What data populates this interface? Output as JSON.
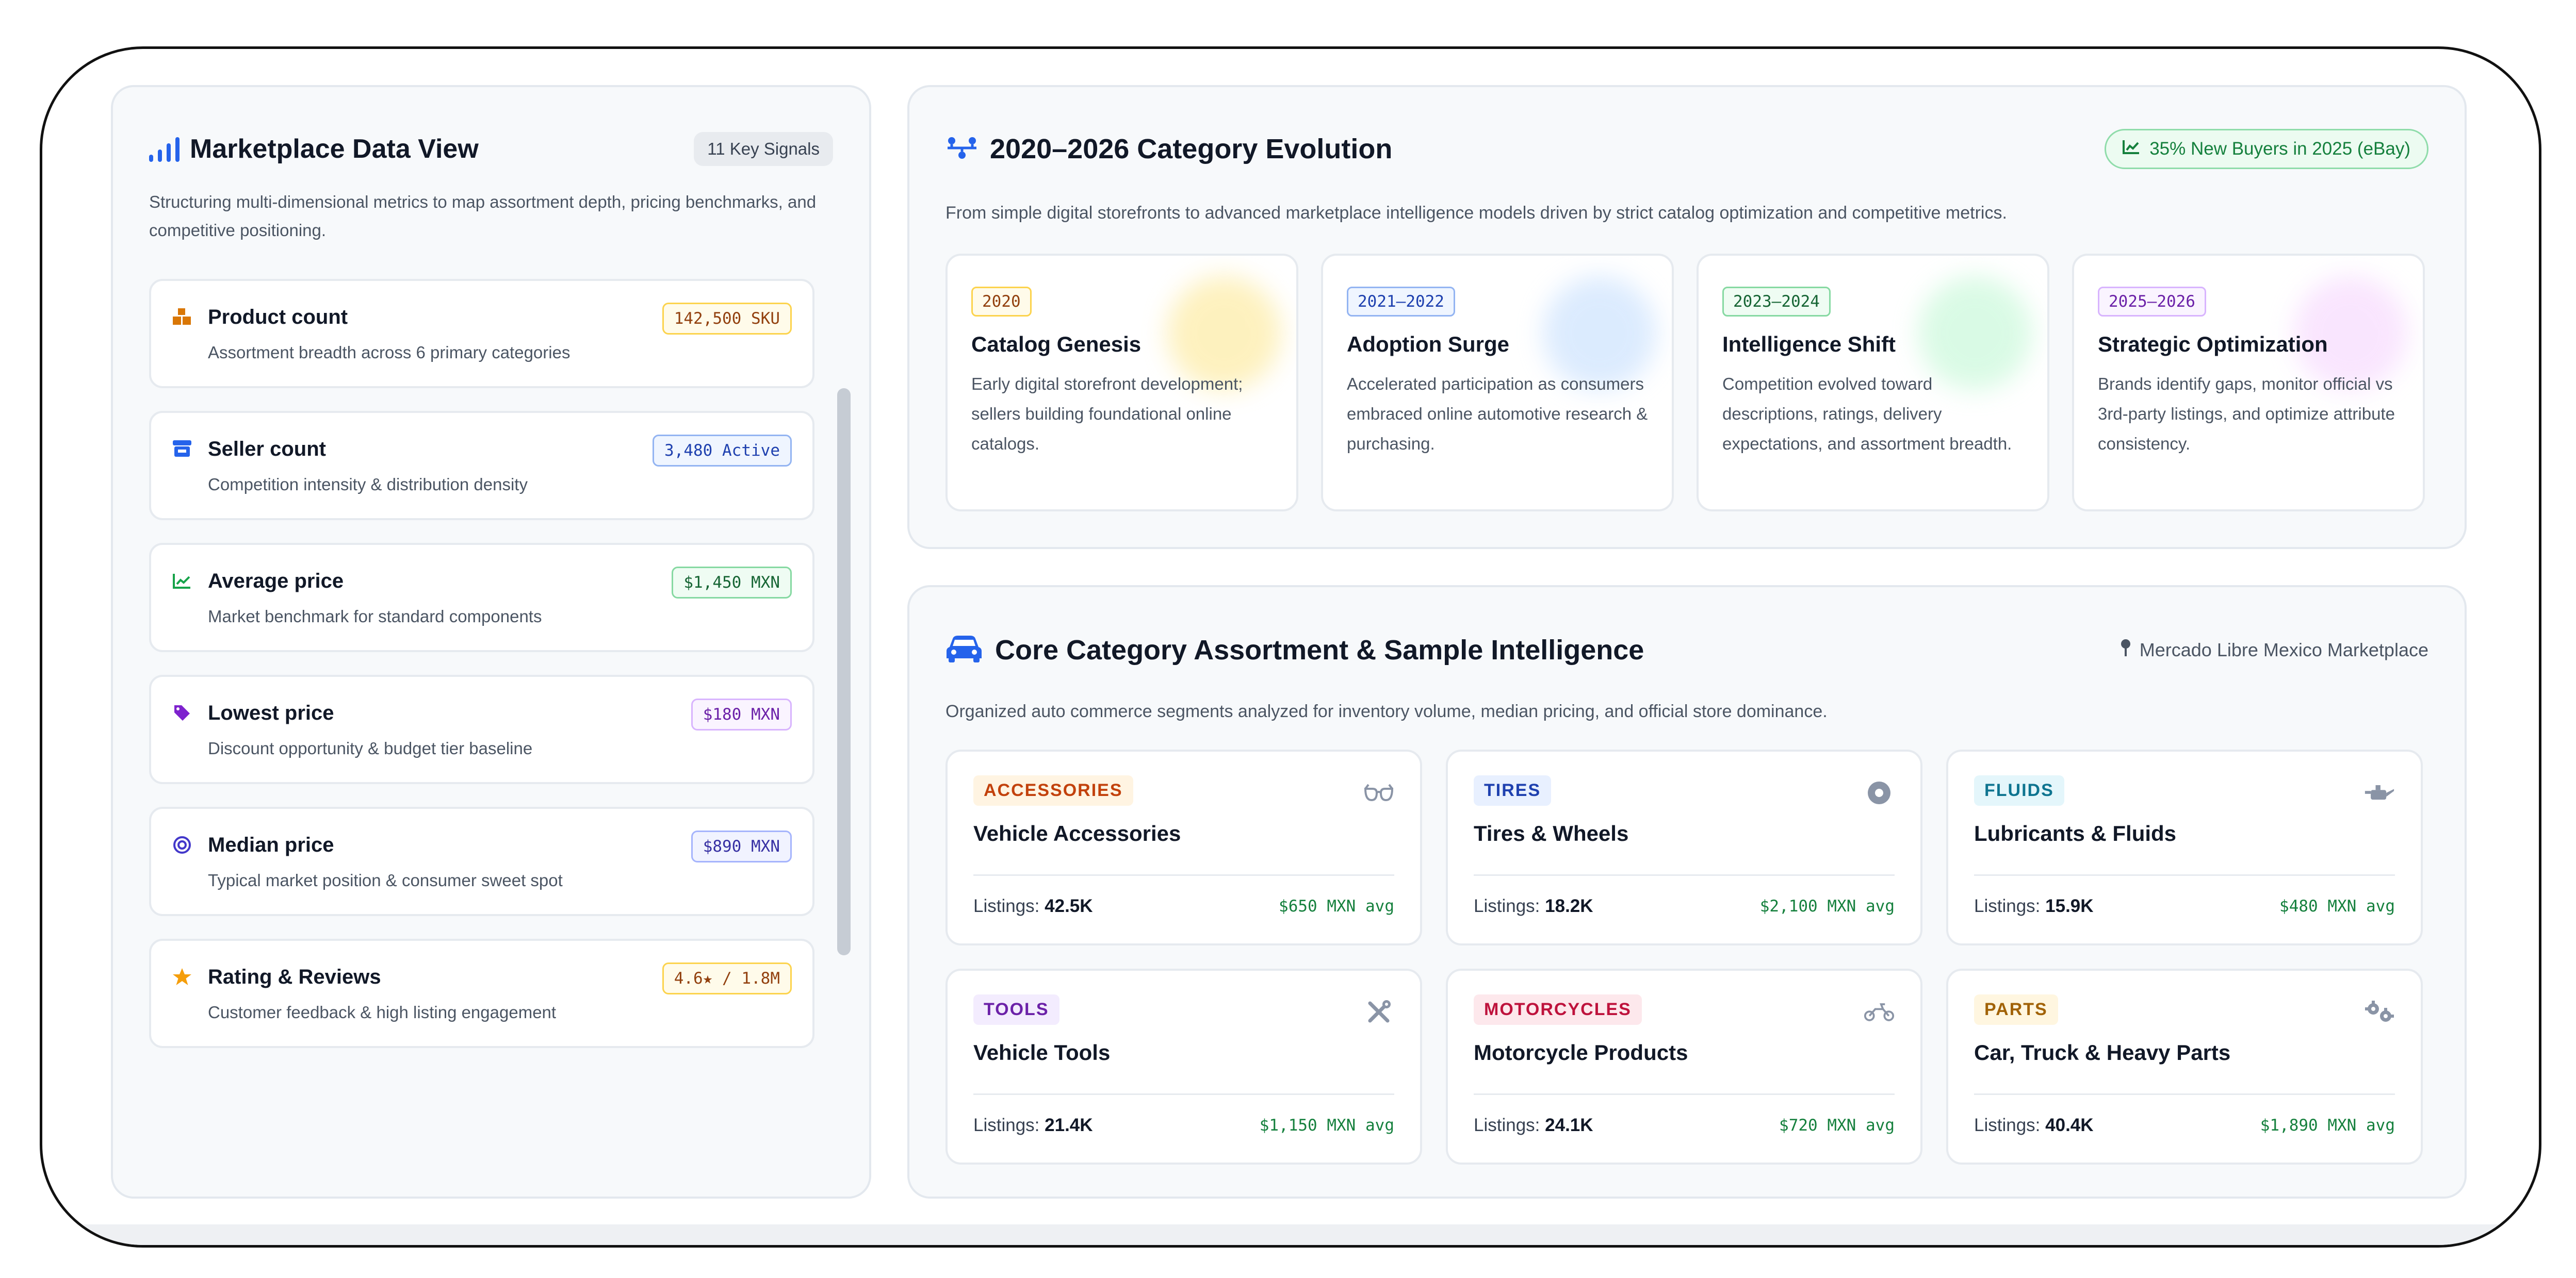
{
  "sidebar": {
    "title": "Marketplace Data View",
    "badge": "11 Key Signals",
    "description": "Structuring multi-dimensional metrics to map assortment depth, pricing benchmarks, and competitive positioning.",
    "metrics": [
      {
        "title": "Product count",
        "desc": "Assortment breadth across 6 primary categories",
        "badge": "142,500 SKU",
        "icon": "boxes-icon",
        "color": "#d97706"
      },
      {
        "title": "Seller count",
        "desc": "Competition intensity & distribution density",
        "badge": "3,480 Active",
        "icon": "store-icon",
        "color": "#2563eb"
      },
      {
        "title": "Average price",
        "desc": "Market benchmark for standard components",
        "badge": "$1,450 MXN",
        "icon": "chart-line-icon",
        "color": "#16a34a"
      },
      {
        "title": "Lowest price",
        "desc": "Discount opportunity & budget tier baseline",
        "badge": "$180 MXN",
        "icon": "tag-icon",
        "color": "#7e22ce"
      },
      {
        "title": "Median price",
        "desc": "Typical market position & consumer sweet spot",
        "badge": "$890 MXN",
        "icon": "target-icon",
        "color": "#4338ca"
      },
      {
        "title": "Rating & Reviews",
        "desc": "Customer feedback & high listing engagement",
        "badge": "4.6★ / 1.8M",
        "icon": "star-icon",
        "color": "#d97706"
      }
    ]
  },
  "evolution": {
    "title": "2020–2026 Category Evolution",
    "badge": "35% New Buyers in 2025 (eBay)",
    "description": "From simple digital storefronts to advanced marketplace intelligence models driven by strict catalog optimization and competitive metrics.",
    "eras": [
      {
        "years": "2020",
        "title": "Catalog Genesis",
        "desc": "Early digital storefront development; sellers building foundational online catalogs."
      },
      {
        "years": "2021–2022",
        "title": "Adoption Surge",
        "desc": "Accelerated participation as consumers embraced online automotive research & purchasing."
      },
      {
        "years": "2023–2024",
        "title": "Intelligence Shift",
        "desc": "Competition evolved toward descriptions, ratings, delivery expectations, and assortment breadth."
      },
      {
        "years": "2025–2026",
        "title": "Strategic Optimization",
        "desc": "Brands identify gaps, monitor official vs 3rd-party listings, and optimize attribute consistency."
      }
    ]
  },
  "core": {
    "title": "Core Category Assortment & Sample Intelligence",
    "marketplace": "Mercado Libre Mexico Marketplace",
    "description": "Organized auto commerce segments analyzed for inventory volume, median pricing, and official store dominance.",
    "listings_label": "Listings:",
    "categories": [
      {
        "tag": "ACCESSORIES",
        "name": "Vehicle Accessories",
        "listings": "42.5K",
        "avg": "$650 MXN avg",
        "icon": "glasses-icon"
      },
      {
        "tag": "TIRES",
        "name": "Tires & Wheels",
        "listings": "18.2K",
        "avg": "$2,100 MXN avg",
        "icon": "tire-icon"
      },
      {
        "tag": "FLUIDS",
        "name": "Lubricants & Fluids",
        "listings": "15.9K",
        "avg": "$480 MXN avg",
        "icon": "oil-can-icon"
      },
      {
        "tag": "TOOLS",
        "name": "Vehicle Tools",
        "listings": "21.4K",
        "avg": "$1,150 MXN avg",
        "icon": "tools-icon"
      },
      {
        "tag": "MOTORCYCLES",
        "name": "Motorcycle Products",
        "listings": "24.1K",
        "avg": "$720 MXN avg",
        "icon": "motorcycle-icon"
      },
      {
        "tag": "PARTS",
        "name": "Car, Truck & Heavy Parts",
        "listings": "40.4K",
        "avg": "$1,890 MXN avg",
        "icon": "gears-icon"
      }
    ]
  }
}
